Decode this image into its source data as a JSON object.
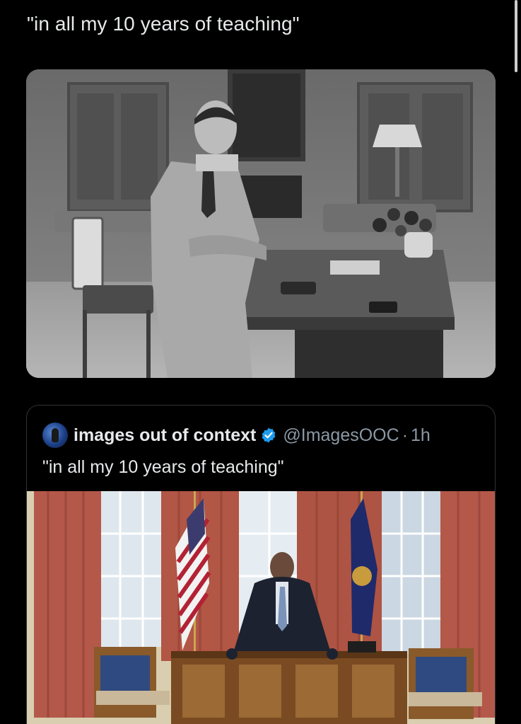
{
  "tweet": {
    "text": "\"in all my 10 years of teaching\""
  },
  "quote": {
    "display_name": "images out of context",
    "handle": "@ImagesOOC",
    "separator": "·",
    "time": "1h",
    "text": "\"in all my 10 years of teaching\"",
    "verified_icon": "verified-badge-icon",
    "verified_color": "#1d9bf0"
  },
  "media": {
    "photo1": "black-and-white photo of a man in a suit leaning against an office desk",
    "photo2": "photo of a man in a suit leaning on a desk in an oval office"
  },
  "colors": {
    "background": "#000000",
    "text": "#e7e9ea",
    "muted": "#8b98a5",
    "border": "#2f3336"
  }
}
